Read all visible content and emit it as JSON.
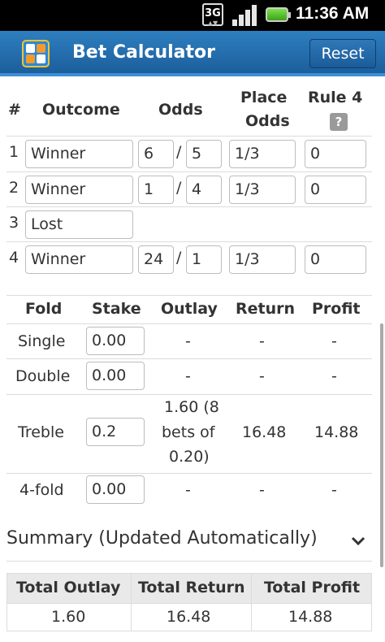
{
  "status_bar": {
    "network": "3G",
    "time": "11:36 AM"
  },
  "app": {
    "title": "Bet Calculator",
    "reset_label": "Reset"
  },
  "selections": {
    "headers": {
      "num": "#",
      "outcome": "Outcome",
      "odds": "Odds",
      "place_odds_1": "Place",
      "place_odds_2": "Odds",
      "rule4": "Rule 4",
      "help": "?"
    },
    "rows": [
      {
        "num": "1",
        "outcome": "Winner",
        "odds_num": "6",
        "sep": "/",
        "odds_den": "5",
        "place": "1/3",
        "rule4": "0"
      },
      {
        "num": "2",
        "outcome": "Winner",
        "odds_num": "1",
        "sep": "/",
        "odds_den": "4",
        "place": "1/3",
        "rule4": "0"
      },
      {
        "num": "3",
        "outcome": "Lost"
      },
      {
        "num": "4",
        "outcome": "Winner",
        "odds_num": "24",
        "sep": "/",
        "odds_den": "1",
        "place": "1/3",
        "rule4": "0"
      }
    ]
  },
  "bets": {
    "headers": {
      "fold": "Fold",
      "stake": "Stake",
      "outlay": "Outlay",
      "return": "Return",
      "profit": "Profit"
    },
    "rows": [
      {
        "fold": "Single",
        "stake": "0.00",
        "outlay": "-",
        "return": "-",
        "profit": "-"
      },
      {
        "fold": "Double",
        "stake": "0.00",
        "outlay": "-",
        "return": "-",
        "profit": "-"
      },
      {
        "fold": "Treble",
        "stake": "0.2",
        "outlay_1": "1.60 (8",
        "outlay_2": "bets of",
        "outlay_3": "0.20)",
        "return": "16.48",
        "profit": "14.88"
      },
      {
        "fold": "4-fold",
        "stake": "0.00",
        "outlay": "-",
        "return": "-",
        "profit": "-"
      }
    ]
  },
  "summary": {
    "title": "Summary (Updated Automatically)",
    "headers": {
      "outlay": "Total Outlay",
      "return": "Total Return",
      "profit": "Total Profit"
    },
    "values": {
      "outlay": "1.60",
      "return": "16.48",
      "profit": "14.88"
    }
  }
}
